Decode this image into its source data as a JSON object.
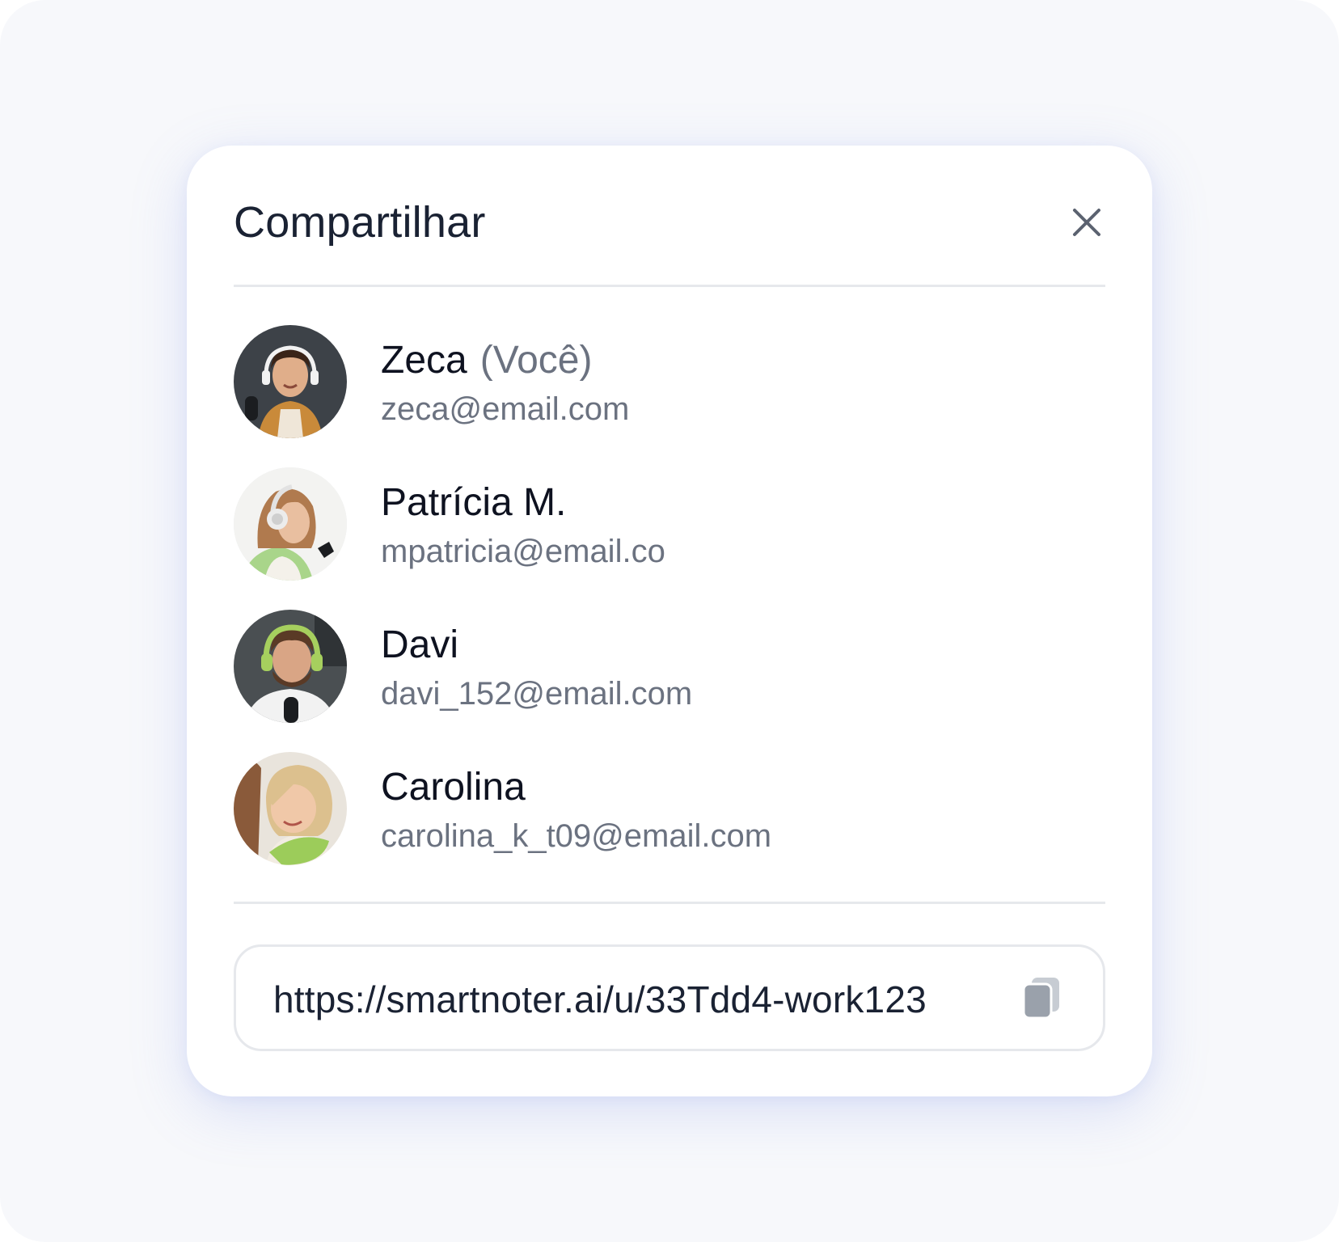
{
  "dialog": {
    "title": "Compartilhar",
    "close_icon": "close-icon"
  },
  "people": [
    {
      "name": "Zeca",
      "you_label": "(Você)",
      "email": "zeca@email.com",
      "avatar_colors": {
        "bg": "#3d4248",
        "skin": "#e0ae8a",
        "hair": "#3a2418",
        "shirt": "#c98a3a"
      }
    },
    {
      "name": "Patrícia M.",
      "you_label": "",
      "email": "mpatricia@email.co",
      "avatar_colors": {
        "bg": "#f3f3f1",
        "skin": "#e9bfa0",
        "hair": "#b07a4e",
        "shirt": "#a9d58a"
      }
    },
    {
      "name": "Davi",
      "you_label": "",
      "email": "davi_152@email.com",
      "avatar_colors": {
        "bg": "#4a4f52",
        "skin": "#d9a585",
        "hair": "#5a3a26",
        "shirt": "#f2f2f2"
      }
    },
    {
      "name": "Carolina",
      "you_label": "",
      "email": "carolina_k_t09@email.com",
      "avatar_colors": {
        "bg": "#e9e4dc",
        "skin": "#f0c8a8",
        "hair": "#dcc08e",
        "shirt": "#9ccc5a"
      }
    }
  ],
  "share_link": {
    "url": "https://smartnoter.ai/u/33Tdd4-work123",
    "copy_icon": "copy-icon"
  },
  "colors": {
    "title": "#1a2233",
    "secondary_text": "#6b7280",
    "divider": "#e6e8ec",
    "icon": "#9aa1ab"
  }
}
